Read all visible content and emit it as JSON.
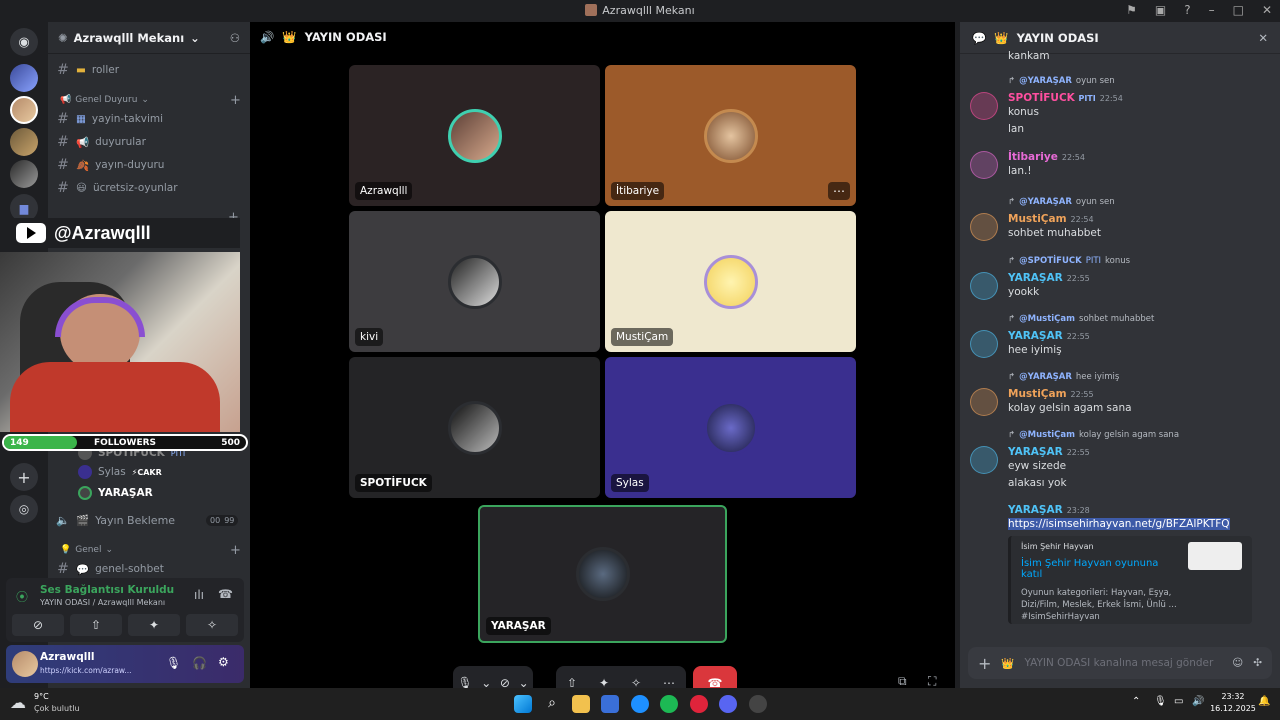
{
  "window": {
    "title": "Azrawqlll Mekanı"
  },
  "guild": {
    "name": "Azrawqlll Mekanı"
  },
  "sidebar": {
    "channels": [
      {
        "label": "roller",
        "emoji": "▬"
      },
      {
        "label": "yayin-takvimi",
        "emoji": "▦"
      },
      {
        "label": "duyurular",
        "emoji": "📢"
      },
      {
        "label": "yayın-duyuru",
        "emoji": "🍂"
      },
      {
        "label": "ücretsiz-oyunlar",
        "emoji": "😃"
      }
    ],
    "categories": [
      "Genel Duyuru",
      "Genel"
    ],
    "voice_users": [
      {
        "name": "SPOTİFUCK",
        "badge": "PITI"
      },
      {
        "name": "Sylas",
        "badge": "⚡CAKR"
      },
      {
        "name": "YARAŞAR"
      }
    ],
    "voice_channel": {
      "label": "Yayın Bekleme",
      "count": "00",
      "limit": "99"
    },
    "text_channel_bottom": "genel-sohbet"
  },
  "overlay": {
    "youtube_handle": "@Azrawqlll",
    "followers_label": "FOLLOWERS",
    "followers_current": "149",
    "followers_goal": "500",
    "followers_fraction": 0.3
  },
  "voice_status": {
    "title": "Ses Bağlantısı Kuruldu",
    "subtitle": "YAYIN ODASI / Azrawqlll Mekanı"
  },
  "user_panel": {
    "name": "Azrawqlll",
    "status": "https://kick.com/azraw..."
  },
  "call": {
    "channel": "YAYIN ODASI",
    "tiles": [
      {
        "name": "Azrawqlll",
        "bg": "#2b2324"
      },
      {
        "name": "İtibariye",
        "bg": "#9c5a2a"
      },
      {
        "name": "kivi",
        "bg": "#3d3c3f"
      },
      {
        "name": "MustiÇam",
        "bg": "#efe8cf"
      },
      {
        "name": "SPOTİFUCK",
        "bg": "#242426"
      },
      {
        "name": "Sylas",
        "bg": "#3a2f8f"
      },
      {
        "name": "YARAŞAR",
        "bg": "#252427"
      }
    ]
  },
  "chat": {
    "channel": "YAYIN ODASI",
    "top_text": "kankam",
    "messages": [
      {
        "reply_user": "@YARAŞAR",
        "reply_text": "oyun sen",
        "user": "SPOTİFUCK",
        "badge": "PITI",
        "time": "22:54",
        "lines": [
          "konus",
          "lan"
        ],
        "color": "#ff4fa0"
      },
      {
        "user": "İtibariye",
        "time": "22:54",
        "lines": [
          "lan.!"
        ],
        "color": "#e86bd6"
      },
      {
        "reply_user": "@YARAŞAR",
        "reply_text": "oyun sen",
        "user": "MustiÇam",
        "time": "22:54",
        "lines": [
          "sohbet muhabbet"
        ],
        "color": "#f0a35a"
      },
      {
        "reply_user": "@SPOTİFUCK",
        "reply_text": "konus",
        "reply_badge": "PITI",
        "user": "YARAŞAR",
        "time": "22:55",
        "lines": [
          "yookk"
        ],
        "color": "#4fc3f7"
      },
      {
        "reply_user": "@MustiÇam",
        "reply_text": "sohbet muhabbet",
        "user": "YARAŞAR",
        "time": "22:55",
        "lines": [
          "hee iyimiş"
        ],
        "color": "#4fc3f7"
      },
      {
        "reply_user": "@YARAŞAR",
        "reply_text": "hee iyimiş",
        "user": "MustiÇam",
        "time": "22:55",
        "lines": [
          "kolay gelsin agam sana"
        ],
        "color": "#f0a35a"
      },
      {
        "reply_user": "@MustiÇam",
        "reply_text": "kolay gelsin agam sana",
        "user": "YARAŞAR",
        "time": "22:55",
        "lines": [
          "eyw sizede",
          "alakası yok"
        ],
        "color": "#4fc3f7"
      },
      {
        "user": "YARAŞAR",
        "time": "23:28",
        "lines": [
          "https://isimsehirhayvan.net/g/BFZAIPKTFQ"
        ],
        "color": "#4fc3f7"
      }
    ],
    "embed": {
      "provider": "İsim Şehir Hayvan",
      "title": "İsim Şehir Hayvan oyununa katıl",
      "description": "Oyunun kategorileri: Hayvan, Eşya, Dizi/Film, Meslek, Erkek İsmi, Ünlü ... #IsimSehirHayvan"
    },
    "composer_placeholder": "YAYIN ODASI kanalına mesaj gönder"
  },
  "taskbar": {
    "weather_temp": "9°C",
    "weather_desc": "Çok bulutlu",
    "time": "23:32",
    "date": "16.12.2025"
  }
}
